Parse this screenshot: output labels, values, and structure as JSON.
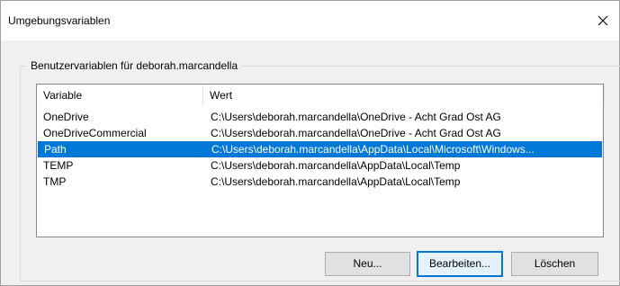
{
  "window": {
    "title": "Umgebungsvariablen"
  },
  "user_vars": {
    "group_label": "Benutzervariablen für deborah.marcandella",
    "columns": [
      "Variable",
      "Wert"
    ],
    "rows": [
      {
        "variable": "OneDrive",
        "value": "C:\\Users\\deborah.marcandella\\OneDrive - Acht Grad Ost AG"
      },
      {
        "variable": "OneDriveCommercial",
        "value": "C:\\Users\\deborah.marcandella\\OneDrive - Acht Grad Ost AG"
      },
      {
        "variable": "Path",
        "value": "C:\\Users\\deborah.marcandella\\AppData\\Local\\Microsoft\\Windows..."
      },
      {
        "variable": "TEMP",
        "value": "C:\\Users\\deborah.marcandella\\AppData\\Local\\Temp"
      },
      {
        "variable": "TMP",
        "value": "C:\\Users\\deborah.marcandella\\AppData\\Local\\Temp"
      }
    ],
    "selected_index": 2
  },
  "buttons": {
    "new_label": "Neu...",
    "edit_label": "Bearbeiten...",
    "delete_label": "Löschen"
  },
  "colors": {
    "selection": "#0078d7",
    "button_face": "#e1e1e1",
    "dialog_bg": "#f0f0f0"
  },
  "icons": {
    "close": "close-icon"
  }
}
